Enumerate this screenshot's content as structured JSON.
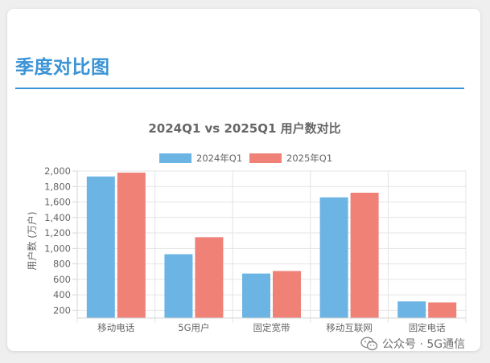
{
  "section": {
    "title": "季度对比图"
  },
  "watermark": {
    "text": "公众号 · 5G通信",
    "icon": "wechat-icon"
  },
  "chart_data": {
    "type": "bar",
    "title": "2024Q1 vs 2025Q1 用户数对比",
    "xlabel": "",
    "ylabel": "用户数 (万户)",
    "categories": [
      "移动电话",
      "5G用户",
      "固定宽带",
      "移动互联网",
      "固定电话"
    ],
    "series": [
      {
        "name": "2024年Q1",
        "color": "#6cb4e4",
        "values": [
          1930,
          925,
          675,
          1660,
          315
        ]
      },
      {
        "name": "2025年Q1",
        "color": "#ef8177",
        "values": [
          1980,
          1145,
          708,
          1720,
          302
        ]
      }
    ],
    "ylim": [
      100,
      2000
    ],
    "yticks": [
      "2,000",
      "1,800",
      "1,600",
      "1,400",
      "1,200",
      "1,000",
      "800",
      "600",
      "400",
      "200"
    ],
    "ytick_values": [
      2000,
      1800,
      1600,
      1400,
      1200,
      1000,
      800,
      600,
      400,
      200
    ],
    "legend_position": "top-center",
    "grid": true
  }
}
